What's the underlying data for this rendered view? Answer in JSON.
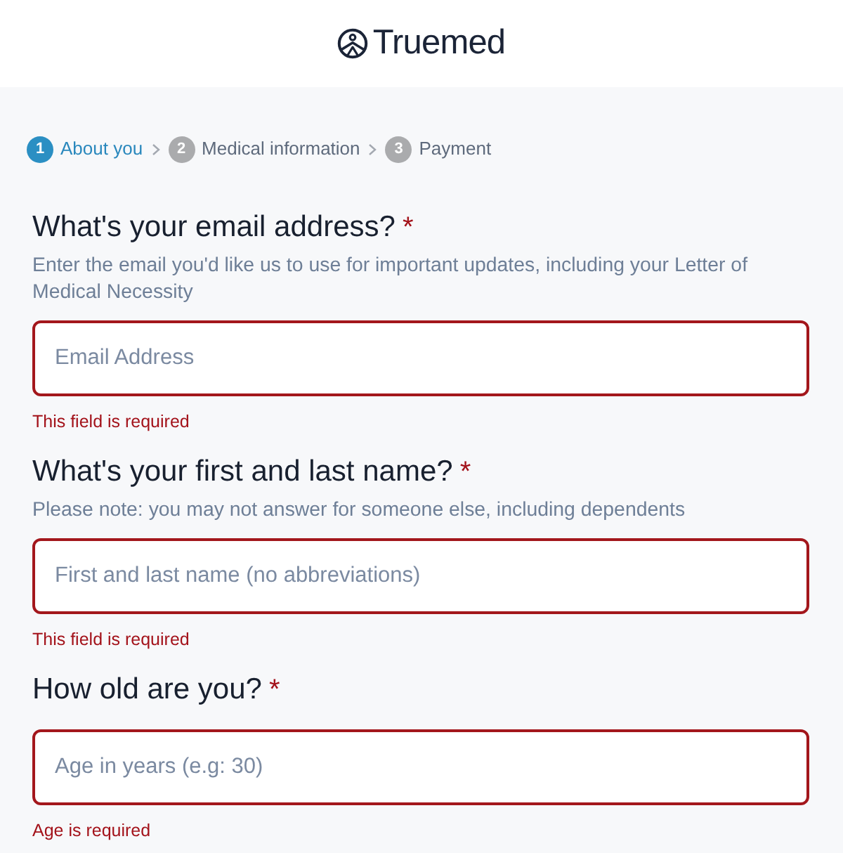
{
  "header": {
    "logo_text": "Truemed"
  },
  "steps": [
    {
      "number": "1",
      "label": "About you",
      "selected": true
    },
    {
      "number": "2",
      "label": "Medical information",
      "selected": false
    },
    {
      "number": "3",
      "label": "Payment",
      "selected": false
    }
  ],
  "questions": [
    {
      "title": "What's your email address?",
      "required_mark": "*",
      "description": "Enter the email you'd like us to use for important updates, including your Letter of Medical Necessity",
      "field": {
        "placeholder": "Email Address",
        "invalid": true
      },
      "error": "This field is required"
    },
    {
      "title": "What's your first and last name?",
      "required_mark": "*",
      "description": "Please note: you may not answer for someone else, including dependents",
      "field": {
        "placeholder": "First and last name (no abbreviations)",
        "invalid": true
      },
      "error": "This field is required"
    },
    {
      "title": "How old are you?",
      "required_mark": "*",
      "field": {
        "placeholder": "Age in years (e.g: 30)",
        "invalid": true
      },
      "error": "Age is required"
    }
  ]
}
